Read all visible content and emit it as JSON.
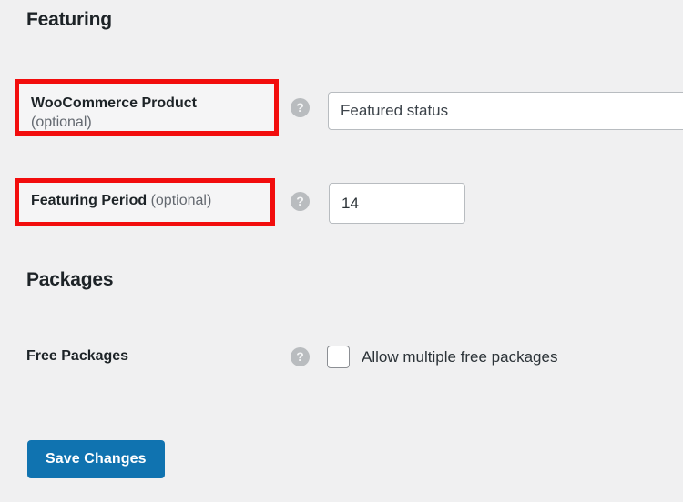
{
  "theme": {
    "background": "#f0f0f1",
    "text_primary": "#1d2327",
    "text_muted": "#646970",
    "annotation_red": "#f20d0d",
    "primary_button": "#1073b0",
    "field_border": "#b8bcc0"
  },
  "sections": {
    "featuring": {
      "heading": "Featuring",
      "rows": {
        "woocommerce_product": {
          "label_main": "WooCommerce Product",
          "label_optional": "(optional)",
          "help_icon": "question-mark-icon",
          "help_glyph": "?",
          "field": {
            "type": "select",
            "value": "Featured status"
          }
        },
        "featuring_period": {
          "label_main": "Featuring Period",
          "label_optional": "(optional)",
          "help_icon": "question-mark-icon",
          "help_glyph": "?",
          "field": {
            "type": "number",
            "value": "14",
            "placeholder": "14"
          }
        }
      }
    },
    "packages": {
      "heading": "Packages",
      "rows": {
        "free_packages": {
          "label_main": "Free Packages",
          "help_icon": "question-mark-icon",
          "help_glyph": "?",
          "checkbox": {
            "label": "Allow multiple free packages",
            "checked": false
          }
        }
      }
    }
  },
  "footer": {
    "save_label": "Save Changes"
  }
}
